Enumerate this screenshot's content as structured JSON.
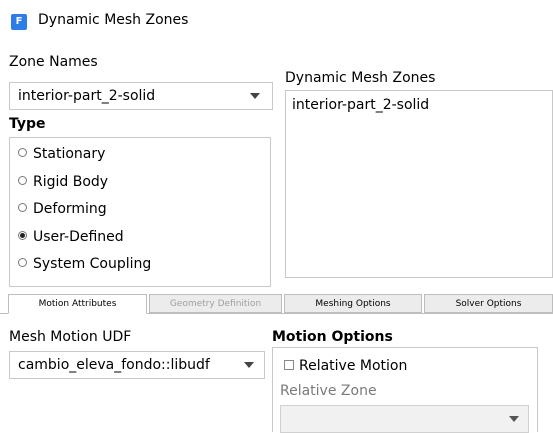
{
  "window": {
    "title": "Dynamic Mesh Zones",
    "icon_letter": "F"
  },
  "zone_names": {
    "label": "Zone Names",
    "selected": "interior-part_2-solid"
  },
  "dynamic_mesh_zones": {
    "label": "Dynamic Mesh Zones",
    "items": [
      "interior-part_2-solid"
    ]
  },
  "type": {
    "label": "Type",
    "options": [
      "Stationary",
      "Rigid Body",
      "Deforming",
      "User-Defined",
      "System Coupling"
    ],
    "selected": "User-Defined"
  },
  "tabs": [
    {
      "label": "Motion Attributes",
      "active": true,
      "enabled": true
    },
    {
      "label": "Geometry Definition",
      "active": false,
      "enabled": false
    },
    {
      "label": "Meshing Options",
      "active": false,
      "enabled": true
    },
    {
      "label": "Solver Options",
      "active": false,
      "enabled": true
    }
  ],
  "mesh_motion_udf": {
    "label": "Mesh Motion UDF",
    "selected": "cambio_eleva_fondo::libudf"
  },
  "motion_options": {
    "label": "Motion Options",
    "relative_motion_label": "Relative Motion",
    "relative_motion_checked": false,
    "relative_zone_label": "Relative Zone",
    "relative_zone_value": ""
  }
}
